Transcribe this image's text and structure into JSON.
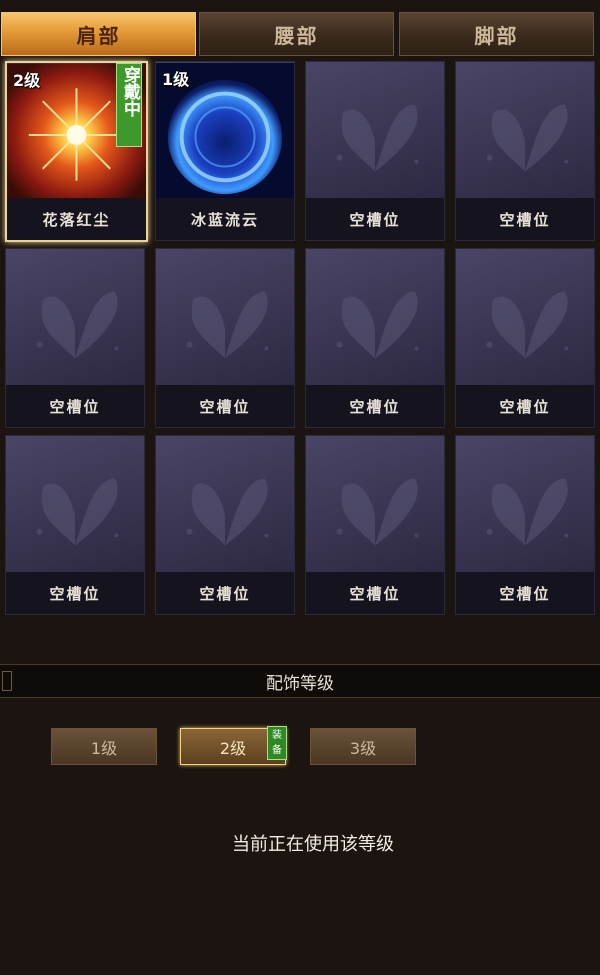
{
  "tabs": [
    {
      "label": "肩部",
      "active": true
    },
    {
      "label": "腰部",
      "active": false
    },
    {
      "label": "脚部",
      "active": false
    }
  ],
  "slots": [
    {
      "name": "花落红尘",
      "level": "2级",
      "worn": "穿戴中",
      "type": "fire"
    },
    {
      "name": "冰蓝流云",
      "level": "1级",
      "type": "ice"
    },
    {
      "name": "空槽位"
    },
    {
      "name": "空槽位"
    },
    {
      "name": "空槽位"
    },
    {
      "name": "空槽位"
    },
    {
      "name": "空槽位"
    },
    {
      "name": "空槽位"
    },
    {
      "name": "空槽位"
    },
    {
      "name": "空槽位"
    },
    {
      "name": "空槽位"
    },
    {
      "name": "空槽位"
    }
  ],
  "section_title": "配饰等级",
  "levels": [
    {
      "label": "1级",
      "active": false
    },
    {
      "label": "2级",
      "active": true
    },
    {
      "label": "3级",
      "active": false
    }
  ],
  "equip_badge": "装备",
  "status_text": "当前正在使用该等级"
}
